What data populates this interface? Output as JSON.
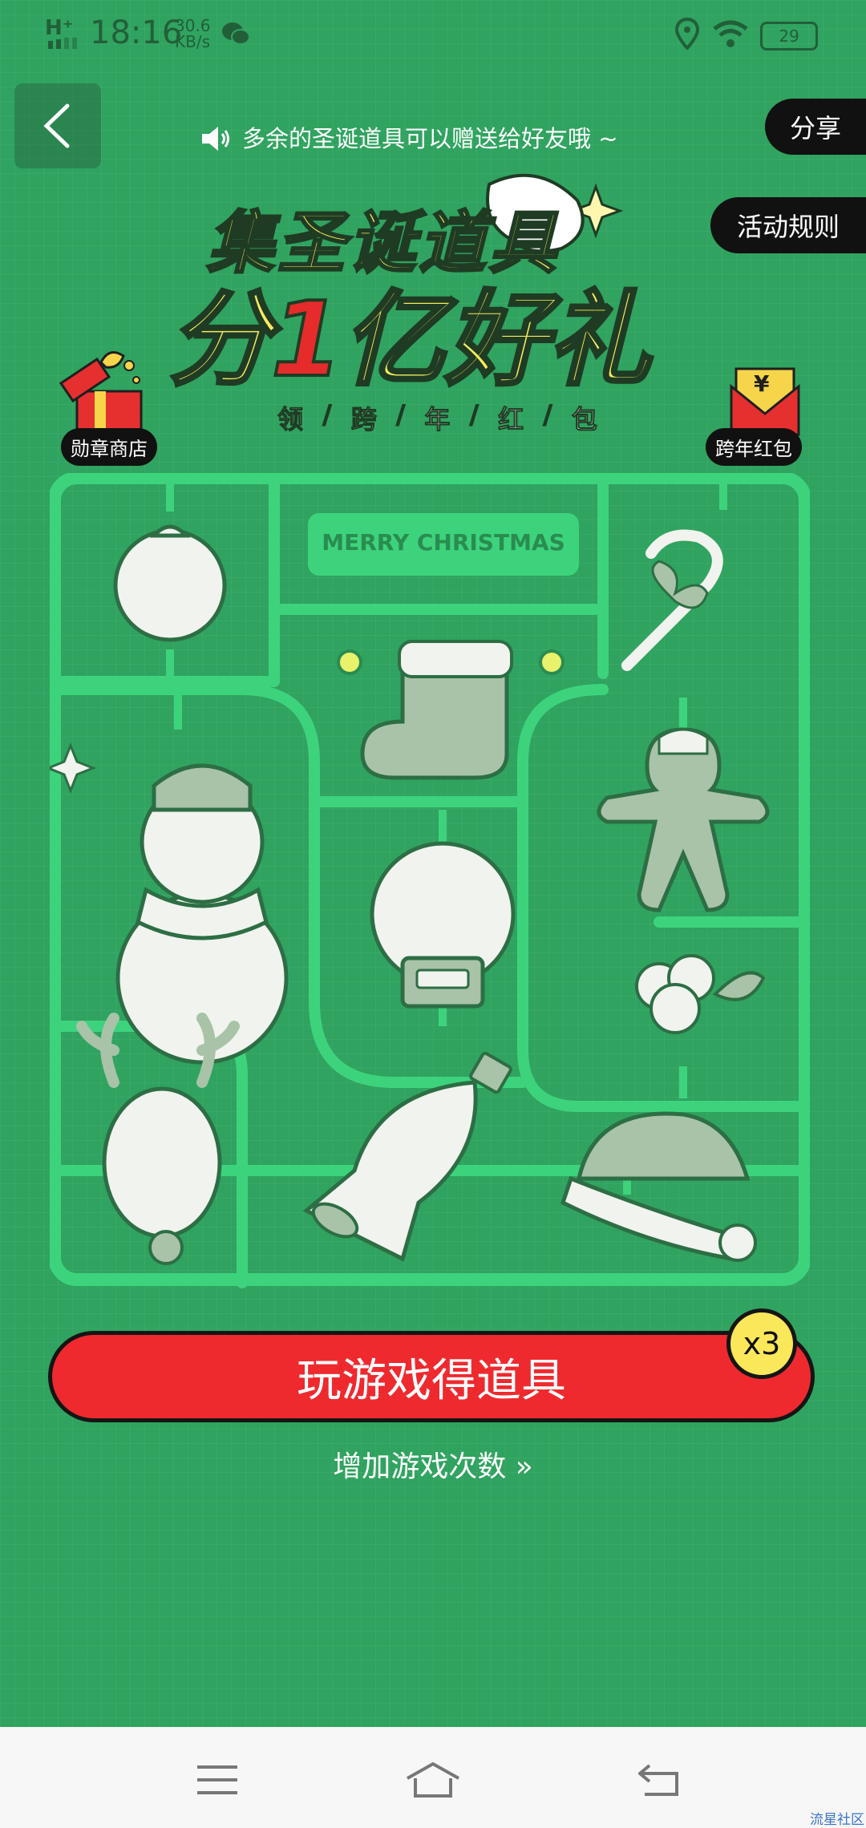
{
  "status_bar": {
    "network": "H⁺",
    "time": "18:16",
    "speed_value": "30.6",
    "speed_unit": "KB/s",
    "battery": "29"
  },
  "header": {
    "notice": "多余的圣诞道具可以赠送给好友哦 ~",
    "share_label": "分享",
    "rules_label": "活动规则"
  },
  "banner": {
    "line1": "集圣诞道具",
    "line2_pre": "分",
    "line2_num": "1",
    "line2_post": "亿好礼",
    "sub": [
      "领",
      "跨",
      "年",
      "红",
      "包"
    ]
  },
  "side": {
    "left_label": "勋章商店",
    "right_label": "跨年红包",
    "yen": "¥"
  },
  "board": {
    "plate_text": "MERRY CHRISTMAS"
  },
  "actions": {
    "play_label": "玩游戏得道具",
    "badge": "x3",
    "more_label": "增加游戏次数 »"
  },
  "watermark": "流星社区",
  "colors": {
    "background": "#2fa35f",
    "frame": "#3dd37d",
    "play_button": "#ee2a2f",
    "badge": "#fbe75a",
    "title_yellow": "#f7ec5e"
  }
}
